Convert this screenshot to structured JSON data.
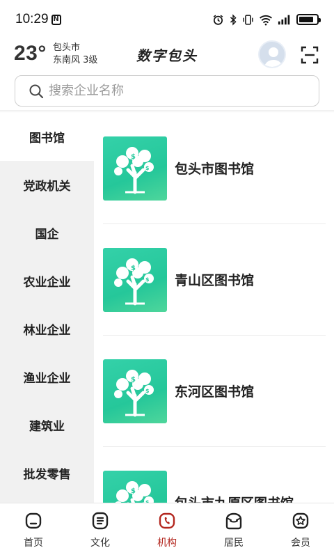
{
  "status": {
    "time": "10:29",
    "notification_badge": "N",
    "battery_level": 0.82
  },
  "weather": {
    "temperature": "23°",
    "city": "包头市",
    "wind": "东南风  3级"
  },
  "app_title": "数字包头",
  "search": {
    "placeholder": "搜索企业名称"
  },
  "sidebar": {
    "items": [
      {
        "label": "图书馆",
        "active": true
      },
      {
        "label": "党政机关"
      },
      {
        "label": "国企"
      },
      {
        "label": "农业企业"
      },
      {
        "label": "林业企业"
      },
      {
        "label": "渔业企业"
      },
      {
        "label": "建筑业"
      },
      {
        "label": "批发零售"
      }
    ]
  },
  "list": {
    "items": [
      {
        "title": "包头市图书馆",
        "logo": "tree-money-logo"
      },
      {
        "title": "青山区图书馆",
        "logo": "tree-money-logo"
      },
      {
        "title": "东河区图书馆",
        "logo": "tree-money-logo"
      },
      {
        "title": "包头市九原区图书馆",
        "logo": "tree-money-logo"
      }
    ]
  },
  "nav": {
    "items": [
      {
        "label": "首页",
        "icon": "home-icon"
      },
      {
        "label": "文化",
        "icon": "culture-icon"
      },
      {
        "label": "机构",
        "icon": "institution-icon",
        "active": true
      },
      {
        "label": "居民",
        "icon": "resident-icon"
      },
      {
        "label": "会员",
        "icon": "member-icon"
      }
    ]
  },
  "colors": {
    "accent": "#b3261e",
    "logo_green": "#2ccca0",
    "sidebar_bg": "#f1f1f1"
  }
}
